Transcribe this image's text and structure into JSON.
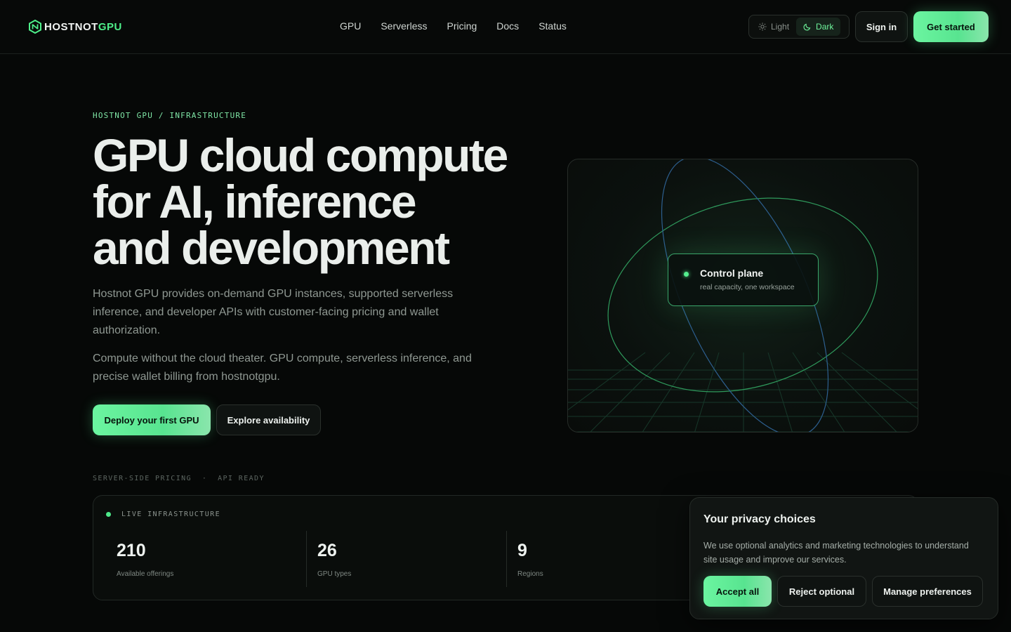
{
  "brand": {
    "part1": "HOSTNOT",
    "part2": "GPU"
  },
  "nav": [
    "GPU",
    "Serverless",
    "Pricing",
    "Docs",
    "Status"
  ],
  "theme": {
    "light": "Light",
    "dark": "Dark",
    "selected": "Dark"
  },
  "header": {
    "signin": "Sign in",
    "get_started": "Get started"
  },
  "hero": {
    "eyebrow": "HOSTNOT GPU / INFRASTRUCTURE",
    "title_lines": [
      "GPU cloud compute",
      "for AI, inference",
      "and development"
    ],
    "lead": "Hostnot GPU provides on-demand GPU instances, supported serverless inference, and developer APIs with customer-facing pricing and wallet authorization.",
    "lead2": "Compute without the cloud theater. GPU compute, serverless inference, and precise wallet billing from hostnotgpu.",
    "cta_primary": "Deploy your first GPU",
    "cta_secondary": "Explore availability",
    "tagline": "SERVER-SIDE PRICING  ·  API READY"
  },
  "visual": {
    "card_title": "Control plane",
    "card_subtitle": "real capacity, one workspace",
    "colors": {
      "green_orbit": "#2f9a5c",
      "blue_orbit": "#2d5f8f",
      "grid": "#17382a"
    }
  },
  "stats": {
    "label": "LIVE INFRASTRUCTURE",
    "items": [
      {
        "value": "210",
        "label": "Available offerings"
      },
      {
        "value": "26",
        "label": "GPU types"
      },
      {
        "value": "9",
        "label": "Regions"
      }
    ]
  },
  "privacy": {
    "title": "Your privacy choices",
    "body": "We use optional analytics and marketing technologies to understand site usage and improve our services.",
    "accept": "Accept all",
    "reject": "Reject optional",
    "manage": "Manage preferences"
  },
  "colors": {
    "accent": "#5cf096",
    "background": "#060807"
  }
}
